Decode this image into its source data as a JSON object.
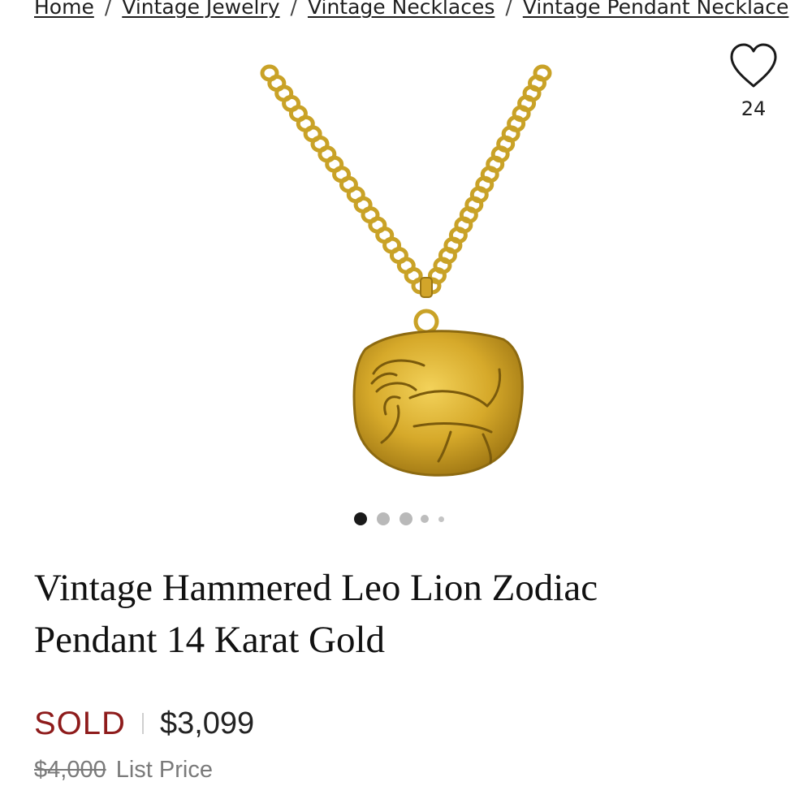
{
  "breadcrumb": {
    "items": [
      "Home",
      "Vintage Jewelry",
      "Vintage Necklaces",
      "Vintage Pendant Necklace"
    ],
    "separator": "/"
  },
  "favorite": {
    "icon": "heart-icon",
    "count": "24"
  },
  "image": {
    "alt": "Vintage Hammered Leo Lion Zodiac Pendant 14 Karat Gold",
    "carousel_total": 5,
    "carousel_active": 1
  },
  "product": {
    "title_line1": "Vintage Hammered Leo Lion Zodiac",
    "title_line2": "Pendant 14 Karat Gold",
    "status": "SOLD",
    "price": "$3,099",
    "list_price": "$4,000",
    "list_price_label": "List Price"
  },
  "colors": {
    "sold": "#8e1b1b",
    "gold": "#c9a227"
  }
}
